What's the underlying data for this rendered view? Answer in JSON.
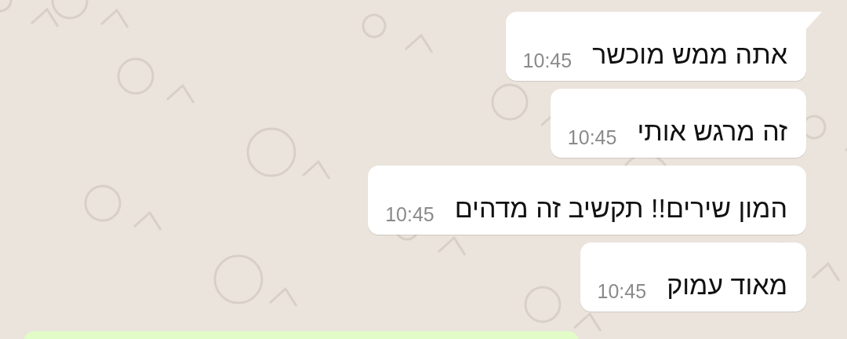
{
  "messages": [
    {
      "kind": "incoming",
      "tail": true,
      "text": "אתה ממש מוכשר",
      "time": "10:45"
    },
    {
      "kind": "incoming",
      "tail": false,
      "text": "זה מרגש אותי",
      "time": "10:45"
    },
    {
      "kind": "incoming",
      "tail": false,
      "text": "המון שירים!! תקשיב זה מדהים",
      "time": "10:45"
    },
    {
      "kind": "incoming",
      "tail": false,
      "text": "מאוד עמוק",
      "time": "10:45"
    },
    {
      "kind": "outgoing"
    }
  ]
}
